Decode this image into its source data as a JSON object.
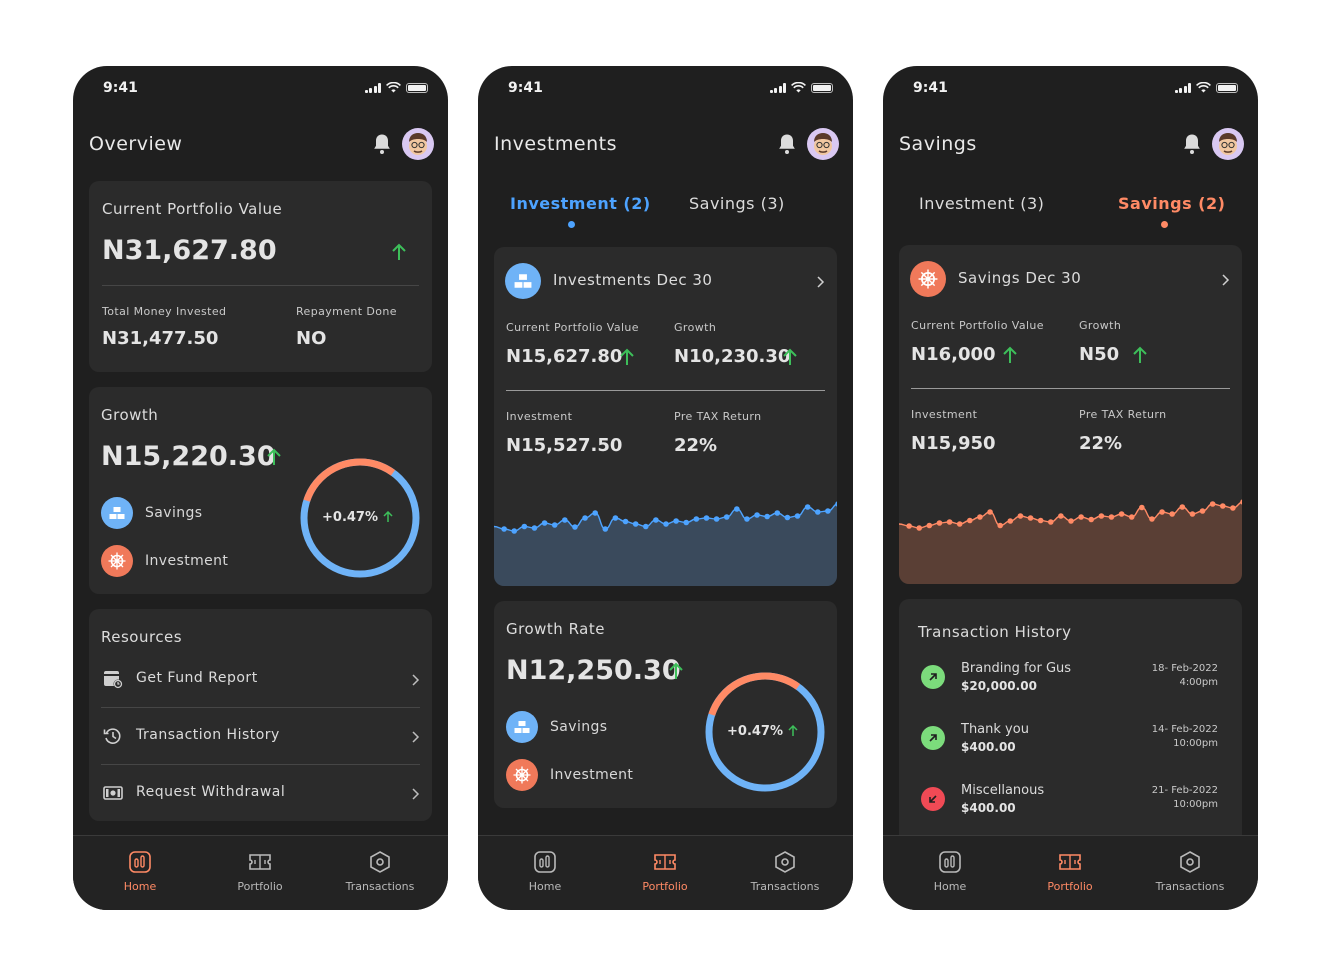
{
  "status": {
    "time": "9:41"
  },
  "colors": {
    "accent_orange": "#ff8a65",
    "accent_blue": "#4da3ff",
    "growth_green": "#3dbf5a",
    "loss_red": "#f04a55",
    "background": "#1f1f1f",
    "card": "#2b2b2b"
  },
  "screens": {
    "overview": {
      "title": "Overview",
      "portfolio": {
        "label": "Current Portfolio Value",
        "value": "N31,627.80",
        "invested_label": "Total Money Invested",
        "invested_value": "N31,477.50",
        "repayment_label": "Repayment Done",
        "repayment_value": "NO"
      },
      "growth": {
        "label": "Growth",
        "value": "N15,220.30",
        "savings_label": "Savings",
        "investment_label": "Investment",
        "donut_text": "+0.47%",
        "savings_share": 0.7
      },
      "resources": {
        "title": "Resources",
        "items": [
          {
            "label": "Get Fund Report",
            "icon": "fund-report-icon"
          },
          {
            "label": "Transaction History",
            "icon": "history-icon"
          },
          {
            "label": "Request Withdrawal",
            "icon": "cash-icon"
          }
        ]
      }
    },
    "investments": {
      "title": "Investments",
      "tabs": [
        {
          "label": "Investment (2)",
          "active": true
        },
        {
          "label": "Savings (3)",
          "active": false
        }
      ],
      "plan": {
        "name": "Investments Dec 30",
        "portfolio_label": "Current Portfolio Value",
        "portfolio_value": "N15,627.80",
        "growth_label": "Growth",
        "growth_value": "N10,230.30",
        "investment_label": "Investment",
        "investment_value": "N15,527.50",
        "pretax_label": "Pre TAX Return",
        "pretax_value": "22%"
      },
      "growth_rate": {
        "label": "Growth Rate",
        "value": "N12,250.30",
        "savings_label": "Savings",
        "investment_label": "Investment",
        "donut_text": "+0.47%",
        "savings_share": 0.7
      }
    },
    "savings": {
      "title": "Savings",
      "tabs": [
        {
          "label": "Investment (3)",
          "active": false
        },
        {
          "label": "Savings (2)",
          "active": true
        }
      ],
      "plan": {
        "name": "Savings Dec 30",
        "portfolio_label": "Current Portfolio Value",
        "portfolio_value": "N16,000",
        "growth_label": "Growth",
        "growth_value": "N50",
        "investment_label": "Investment",
        "investment_value": "N15,950",
        "pretax_label": "Pre TAX Return",
        "pretax_value": "22%"
      },
      "history": {
        "title": "Transaction History",
        "items": [
          {
            "name": "Branding for Gus",
            "amount": "$20,000.00",
            "date": "18- Feb-2022",
            "time": "4:00pm",
            "direction": "in"
          },
          {
            "name": "Thank you",
            "amount": "$400.00",
            "date": "14- Feb-2022",
            "time": "10:00pm",
            "direction": "in"
          },
          {
            "name": "Miscellanous",
            "amount": "$400.00",
            "date": "21- Feb-2022",
            "time": "10:00pm",
            "direction": "out"
          }
        ]
      }
    }
  },
  "nav": {
    "items": [
      {
        "label": "Home",
        "icon": "home-chart-icon"
      },
      {
        "label": "Portfolio",
        "icon": "portfolio-ticket-icon"
      },
      {
        "label": "Transactions",
        "icon": "transactions-hex-icon"
      }
    ]
  },
  "chart_data": [
    {
      "type": "area",
      "series": [
        {
          "values": [
            55,
            50,
            46,
            55,
            52,
            62,
            58,
            68,
            54,
            72,
            82,
            50,
            72,
            65,
            60,
            55,
            68,
            60,
            66,
            63,
            70,
            72,
            70,
            74,
            90,
            70,
            78,
            75,
            82,
            73,
            76,
            94,
            84,
            86,
            100
          ]
        }
      ],
      "color": "#4da3ff"
    },
    {
      "type": "area",
      "series": [
        {
          "values": [
            56,
            52,
            48,
            53,
            58,
            60,
            56,
            63,
            70,
            80,
            53,
            62,
            72,
            68,
            63,
            60,
            72,
            62,
            70,
            65,
            72,
            70,
            76,
            70,
            89,
            66,
            80,
            76,
            90,
            76,
            82,
            96,
            92,
            88,
            100
          ]
        }
      ],
      "color": "#ff8a65"
    }
  ]
}
